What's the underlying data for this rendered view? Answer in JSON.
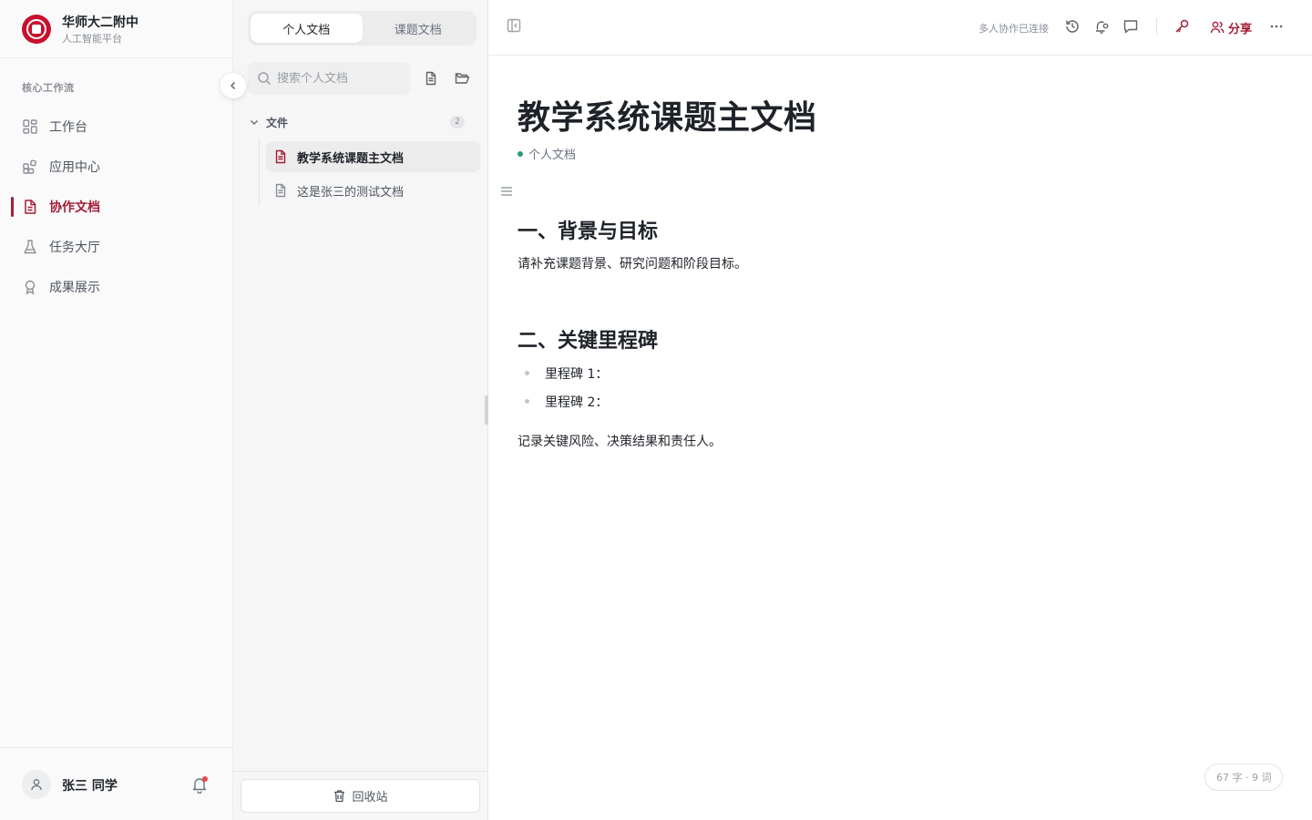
{
  "brand": {
    "name": "华师大二附中",
    "subtitle": "人工智能平台"
  },
  "sidebar": {
    "section_label": "核心工作流",
    "items": [
      {
        "label": "工作台",
        "icon": "dashboard-icon",
        "active": false
      },
      {
        "label": "应用中心",
        "icon": "apps-icon",
        "active": false
      },
      {
        "label": "协作文档",
        "icon": "document-icon",
        "active": true
      },
      {
        "label": "任务大厅",
        "icon": "flask-icon",
        "active": false
      },
      {
        "label": "成果展示",
        "icon": "award-icon",
        "active": false
      }
    ]
  },
  "user": {
    "name": "张三 同学"
  },
  "docs_panel": {
    "tabs": [
      {
        "label": "个人文档",
        "active": true
      },
      {
        "label": "课题文档",
        "active": false
      }
    ],
    "search_placeholder": "搜索个人文档",
    "folder": {
      "name": "文件",
      "count": "2"
    },
    "files": [
      {
        "label": "教学系统课题主文档",
        "active": true
      },
      {
        "label": "这是张三的测试文档",
        "active": false
      }
    ],
    "trash_label": "回收站"
  },
  "toolbar": {
    "collab_status": "多人协作已连接",
    "share_label": "分享"
  },
  "document": {
    "title": "教学系统课题主文档",
    "meta_label": "个人文档",
    "heading1": "一、背景与目标",
    "paragraph1": "请补充课题背景、研究问题和阶段目标。",
    "heading2": "二、关键里程碑",
    "list": [
      "里程碑 1：",
      "里程碑 2："
    ],
    "paragraph2": "记录关键风险、决策结果和责任人。"
  },
  "status": {
    "word_count": "67 字 · 9 词"
  },
  "colors": {
    "accent": "#a31d36",
    "online": "#22a06b",
    "logo": "#c8102e"
  }
}
